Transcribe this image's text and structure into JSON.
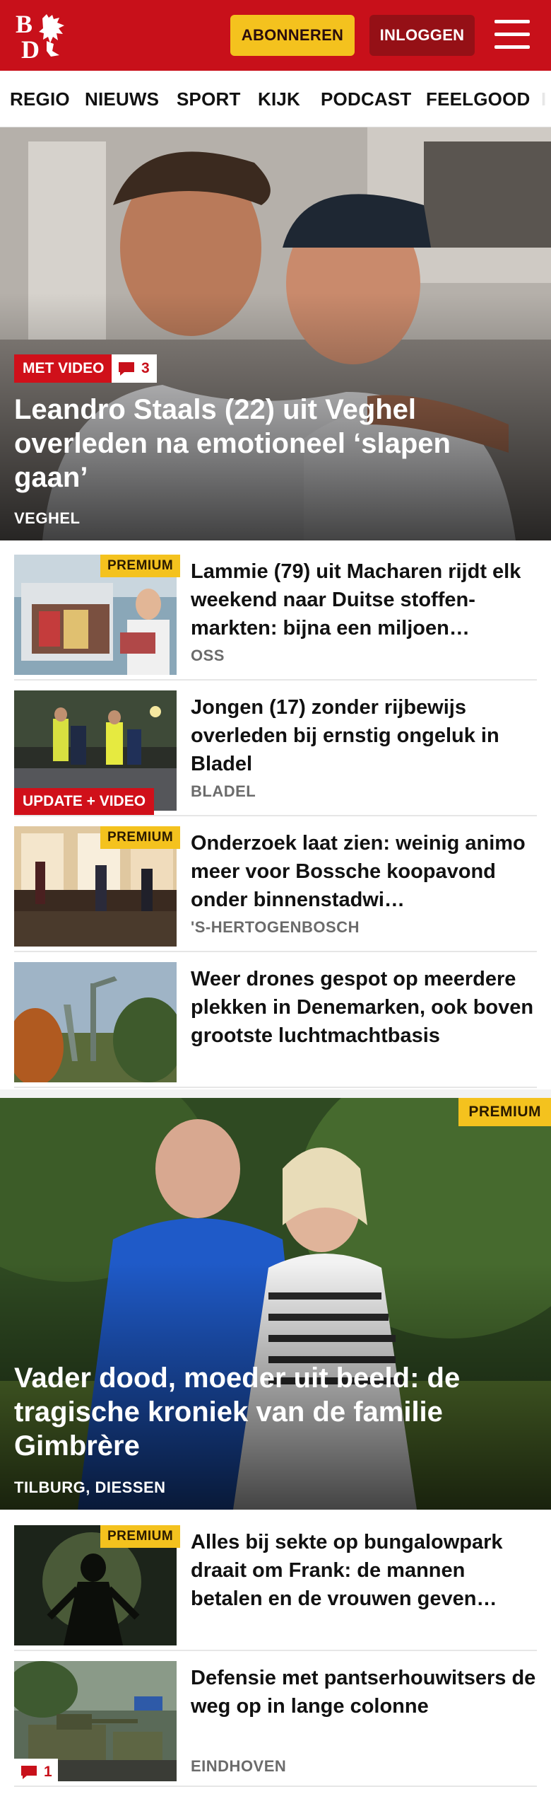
{
  "header": {
    "logo_text": "BD",
    "subscribe_label": "ABONNEREN",
    "login_label": "INLOGGEN",
    "brand_color": "#c8101a",
    "accent_color": "#f4c21e"
  },
  "nav": {
    "items": [
      "REGIO",
      "NIEUWS",
      "SPORT",
      "KIJK",
      "PODCAST",
      "FEELGOOD"
    ]
  },
  "hero1": {
    "video_tag": "MET VIDEO",
    "comments": "3",
    "title": "Leandro Staals (22) uit Veghel overleden na emotioneel ‘slapen gaan’",
    "location": "VEGHEL"
  },
  "articles": [
    {
      "badge": "PREMIUM",
      "title": "Lammie (79) uit Macharen rijdt elk weekend naar Duitse stoffen-markten: bijna een miljoen…",
      "location": "OSS"
    },
    {
      "badge": "UPDATE + VIDEO",
      "title": "Jongen (17) zonder rijbewijs overleden bij ernstig ongeluk in Bladel",
      "location": "BLADEL"
    },
    {
      "badge": "PREMIUM",
      "title": "Onderzoek laat zien: weinig animo meer voor Bossche koopavond onder binnenstadwi…",
      "location": "'S-HERTOGENBOSCH"
    },
    {
      "title": "Weer drones gespot op meerdere plekken in Denemarken, ook boven grootste luchtmachtbasis"
    }
  ],
  "hero2": {
    "badge": "PREMIUM",
    "title": "Vader dood, moeder uit beeld: de tragische kroniek van de familie Gimbrère",
    "location": "TILBURG, DIESSEN"
  },
  "articles2": [
    {
      "badge": "PREMIUM",
      "title": "Alles bij sekte op bungalowpark draait om Frank: de mannen betalen en de vrouwen geven…"
    },
    {
      "comments": "1",
      "title": "Defensie met pantserhouwitsers de weg op in lange colonne",
      "location": "EINDHOVEN"
    }
  ]
}
